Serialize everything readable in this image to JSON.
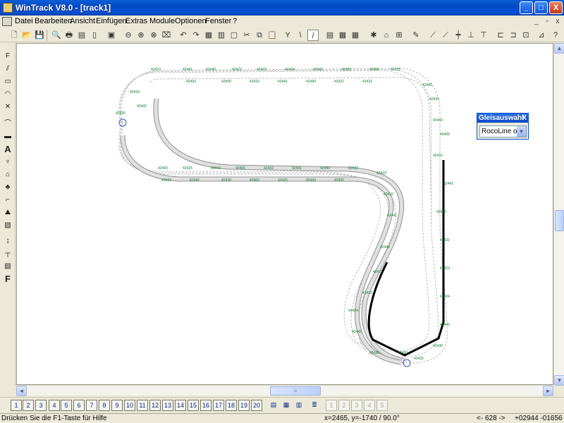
{
  "window": {
    "title": "WinTrack  V8.0 - [track1]",
    "minimize": "_",
    "maximize": "□",
    "close": "X"
  },
  "menu": {
    "items": [
      "Datei",
      "Bearbeiten",
      "Ansicht",
      "Einfügen",
      "Extras",
      "Module",
      "Optionen",
      "Fenster",
      "?"
    ]
  },
  "mdi": {
    "minimize": "_",
    "restore": "▫",
    "close": "x"
  },
  "gleisauswahl": {
    "title": "Gleisauswahl",
    "close": "X",
    "value": "RocoLine ohn",
    "arrow": "▼"
  },
  "track_labels": [
    "42410",
    "42441",
    "42440",
    "42422",
    "42423",
    "42424",
    "42442",
    "42430",
    "42460",
    "42425",
    "42443",
    "42405"
  ],
  "layers": [
    "1",
    "2",
    "3",
    "4",
    "5",
    "6",
    "7",
    "8",
    "9",
    "10",
    "11",
    "12",
    "13",
    "14",
    "15",
    "16",
    "17",
    "18",
    "19",
    "20"
  ],
  "layer_extra": [
    "1",
    "2",
    "3",
    "4",
    "5"
  ],
  "status": {
    "hint": "Drücken Sie die  F1-Taste für Hilfe",
    "coords": "x=2465, y=-1740 / 90.0°",
    "nav": "<- 628 ->",
    "pos": "+02944  -01656"
  },
  "scroll": {
    "up": "▲",
    "down": "▼",
    "left": "◄",
    "right": "►",
    "grip": "≡"
  },
  "colors": {
    "titlebar": "#0552d8",
    "track_dashed": "#b8b8b8",
    "track_label": "#0a7a2a",
    "track_bold": "#000000"
  }
}
